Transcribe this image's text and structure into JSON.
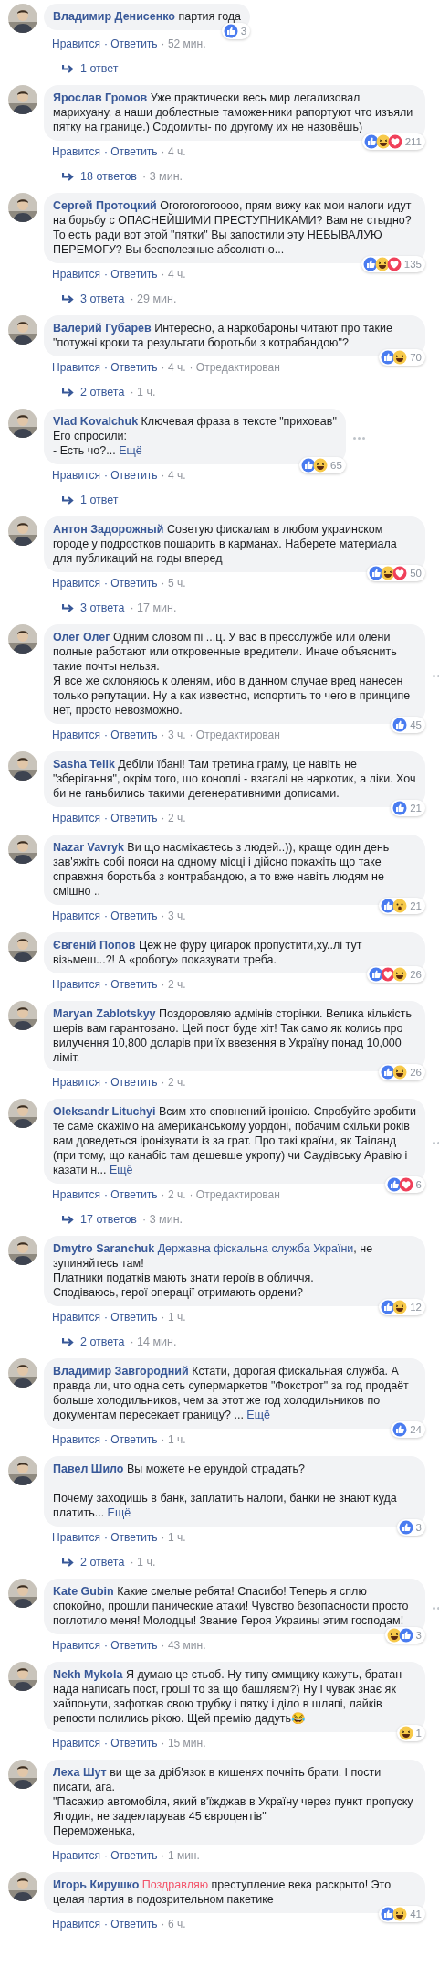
{
  "comments": [
    {
      "author": "Владимир Денисенко",
      "text": "партия года",
      "reactions": [
        {
          "kind": "like"
        }
      ],
      "reaction_count": "3",
      "actions": {
        "like": "Нравится",
        "reply": "· Ответить",
        "time": "· 52 мин."
      },
      "replies": {
        "label": "1 ответ"
      }
    },
    {
      "author": "Ярослав Громов",
      "text": "Уже практически весь мир легализовал марихуану, а наши доблестные таможенники рапортуют что изъяли пятку на границе.) Содомиты- по другому их не назовёшь)",
      "reactions": [
        {
          "kind": "like"
        },
        {
          "kind": "haha"
        },
        {
          "kind": "love"
        }
      ],
      "reaction_count": "211",
      "actions": {
        "like": "Нравится",
        "reply": "· Ответить",
        "time": "· 4 ч."
      },
      "replies": {
        "label": "18 ответов",
        "time": "· 3 мин."
      }
    },
    {
      "author": "Сергей Протоцкий",
      "text": "Огогогогогоооо, прям вижу как мои налоги идут на борьбу с ОПАСНЕЙШИМИ ПРЕСТУПНИКАМИ? Вам не стыдно? То есть ради вот этой \"пятки\" Вы запостили эту НЕБЫВАЛУЮ ПЕРЕМОГУ? Вы бесполезные абсолютно...",
      "reactions": [
        {
          "kind": "like"
        },
        {
          "kind": "haha"
        },
        {
          "kind": "love"
        }
      ],
      "reaction_count": "135",
      "actions": {
        "like": "Нравится",
        "reply": "· Ответить",
        "time": "· 4 ч."
      },
      "replies": {
        "label": "3 ответа",
        "time": "· 29 мин."
      }
    },
    {
      "author": "Валерий Губарев",
      "text": "Интересно, а наркобароны читают про такие \"потужні кроки та результати боротьби з котрабандою\"?",
      "reactions": [
        {
          "kind": "like"
        },
        {
          "kind": "haha"
        }
      ],
      "reaction_count": "70",
      "actions": {
        "like": "Нравится",
        "reply": "· Ответить",
        "time": "· 4 ч.",
        "edited": "· Отредактирован"
      },
      "replies": {
        "label": "2 ответа",
        "time": "· 1 ч."
      }
    },
    {
      "author": "Vlad Kovalchuk",
      "text": "Ключевая фраза в тексте \"приховав\"\nЕго спросили:\n- Есть чо?...",
      "more": "Ещё",
      "menu_visible": true,
      "reactions": [
        {
          "kind": "like"
        },
        {
          "kind": "haha"
        }
      ],
      "reaction_count": "65",
      "actions": {
        "like": "Нравится",
        "reply": "· Ответить",
        "time": "· 4 ч."
      },
      "replies": {
        "label": "1 ответ"
      }
    },
    {
      "author": "Антон Задорожный",
      "text": "Советую фискалам в любом украинском городе у подростков пошарить в карманах. Наберете материала для публикаций на годы вперед",
      "reactions": [
        {
          "kind": "like"
        },
        {
          "kind": "haha"
        },
        {
          "kind": "love"
        }
      ],
      "reaction_count": "50",
      "actions": {
        "like": "Нравится",
        "reply": "· Ответить",
        "time": "· 5 ч."
      },
      "replies": {
        "label": "3 ответа",
        "time": "· 17 мин."
      }
    },
    {
      "author": "Олег Олег",
      "text": "Одним словом пі ...ц. У вас в пресслужбе или олени полные работают или откровенные вредители. Иначе объяснить такие почты нельзя.\nЯ все же склоняюсь к оленям, ибо в данном случае вред нанесен только репутации. Ну а как известно, испортить то чего в принципе нет, просто невозможно.",
      "menu_visible": true,
      "reactions": [
        {
          "kind": "like"
        }
      ],
      "reaction_count": "45",
      "actions": {
        "like": "Нравится",
        "reply": "· Ответить",
        "time": "· 3 ч.",
        "edited": "· Отредактирован"
      }
    },
    {
      "author": "Sasha Telik",
      "text": "Дебіли їбані! Там третина граму, це навіть не \"зберігання\", окрім того, шо коноплі - взагалі не наркотик, а ліки. Хоч би не ганьбились такими дегенеративними дописами.",
      "reactions": [
        {
          "kind": "like"
        }
      ],
      "reaction_count": "21",
      "actions": {
        "like": "Нравится",
        "reply": "· Ответить",
        "time": "· 2 ч."
      }
    },
    {
      "author": "Nazar Vavryk",
      "text": "Ви що насміхаєтесь з людей..)), краще один день зав'яжіть собі пояси на одному місці і дійсно покажіть що таке справжня боротьба з контрабандою, а то вже навіть людям не смішно ..",
      "reactions": [
        {
          "kind": "like"
        },
        {
          "kind": "wow"
        }
      ],
      "reaction_count": "21",
      "actions": {
        "like": "Нравится",
        "reply": "· Ответить",
        "time": "· 3 ч."
      }
    },
    {
      "author": "Євгеній Попов",
      "text": "Цеж не фуру цигарок пропустити,ху..лі тут візьмеш...?! А «роботу» показувати треба.",
      "reactions": [
        {
          "kind": "like"
        },
        {
          "kind": "love"
        },
        {
          "kind": "haha"
        }
      ],
      "reaction_count": "26",
      "actions": {
        "like": "Нравится",
        "reply": "· Ответить",
        "time": "· 2 ч."
      }
    },
    {
      "author": "Maryan Zablotskyy",
      "text": "Поздоровляю адмінів сторінки. Велика кількість шерів вам гарантовано. Цей пост буде хіт! Так само як колись про вилучення 10,800 доларів при їх ввезення в Україну понад 10,000 ліміт.",
      "reactions": [
        {
          "kind": "like"
        },
        {
          "kind": "haha"
        }
      ],
      "reaction_count": "26",
      "actions": {
        "like": "Нравится",
        "reply": "· Ответить",
        "time": "· 2 ч."
      }
    },
    {
      "author": "Oleksandr Lituchyi",
      "text": "Всим хто сповнений іронією. Спробуйте зробити те саме скажімо на американському уордоні, побачим скільки років вам доведеться іронізувати із за грат. Про такі країни, як Таіланд (при тому, що канабіс там дешевше укропу) чи Саудівську Аравію і казати н...",
      "more": "Ещё",
      "menu_visible": true,
      "reactions": [
        {
          "kind": "like"
        },
        {
          "kind": "love"
        }
      ],
      "reaction_count": "6",
      "actions": {
        "like": "Нравится",
        "reply": "· Ответить",
        "time": "· 2 ч.",
        "edited": "· Отредактирован"
      },
      "replies": {
        "label": "17 ответов",
        "time": "· 3 мин."
      }
    },
    {
      "author": "Dmytro Saranchuk",
      "mention": {
        "text": "Державна фіскальна служба України",
        "kind": "page"
      },
      "text": ", не зупиняйтесь там!\nПлатники податків мають знати героїв в обличчя.\nСподіваюсь, герої операції отримають ордени?",
      "reactions": [
        {
          "kind": "like"
        },
        {
          "kind": "haha"
        }
      ],
      "reaction_count": "12",
      "actions": {
        "like": "Нравится",
        "reply": "· Ответить",
        "time": "· 1 ч."
      },
      "replies": {
        "label": "2 ответа",
        "time": "· 14 мин."
      }
    },
    {
      "author": "Владимир Завгородний",
      "text": "Кстати, дорогая фискальная служба. А правда ли, что одна сеть супермаркетов \"Фокстрот\" за год продаёт больше холодильников, чем за этот же год холодильников по документам пересекает границу? ...",
      "more": "Ещё",
      "reactions": [
        {
          "kind": "like"
        }
      ],
      "reaction_count": "24",
      "actions": {
        "like": "Нравится",
        "reply": "· Ответить",
        "time": "· 1 ч."
      }
    },
    {
      "author": "Павел Шило",
      "text": "Вы можете не ерундой страдать?\n\nПочему заходишь в банк, заплатить налоги, банки не знают куда платить...",
      "more": "Ещё",
      "reactions": [
        {
          "kind": "like"
        }
      ],
      "reaction_count": "3",
      "actions": {
        "like": "Нравится",
        "reply": "· Ответить",
        "time": "· 1 ч."
      },
      "replies": {
        "label": "2 ответа",
        "time": "· 1 ч."
      }
    },
    {
      "author": "Kate Gubin",
      "text": "Какие смелые ребята! Спасибо! Теперь я сплю спокойно, прошли панические атаки! Чувство безопасности просто поглотило меня! Молодцы! Звание Героя Украины этим господам!",
      "menu_visible": true,
      "reactions": [
        {
          "kind": "haha"
        },
        {
          "kind": "like"
        }
      ],
      "reaction_count": "3",
      "actions": {
        "like": "Нравится",
        "reply": "· Ответить",
        "time": "· 43 мин."
      }
    },
    {
      "author": "Nekh Mykola",
      "text": "Я думаю це стьоб. Ну типу сммщику кажуть, братан нада написать пост, гроші то за що башляєм?) Ну і чувак знає як хайпонути, зафоткав свою трубку і пятку і діло в шляпі, лайків репости полились рікою. Щей премію дадуть😂",
      "reactions": [
        {
          "kind": "haha"
        }
      ],
      "reaction_count": "1",
      "actions": {
        "like": "Нравится",
        "reply": "· Ответить",
        "time": "· 15 мин."
      }
    },
    {
      "author": "Леха Шут",
      "text": "ви ще за дріб'язок в кишенях почніть брати. І пости писати, ага.\n\"Пасажир автомобіля, який в'їжджав в Україну через пункт пропуску Ягодин, не задекларував 45 євроцентів\"\nПереможенька,",
      "actions": {
        "like": "Нравится",
        "reply": "· Ответить",
        "time": "· 1 мин."
      }
    },
    {
      "author": "Игорь Кирушко",
      "mention": {
        "text": "Поздравляю",
        "kind": "celebration"
      },
      "text": "преступление века раскрыто! Это целая партия в подозрительном пакетике",
      "reactions": [
        {
          "kind": "like"
        },
        {
          "kind": "haha"
        }
      ],
      "reaction_count": "41",
      "actions": {
        "like": "Нравится",
        "reply": "· Ответить",
        "time": "· 6 ч."
      }
    }
  ]
}
